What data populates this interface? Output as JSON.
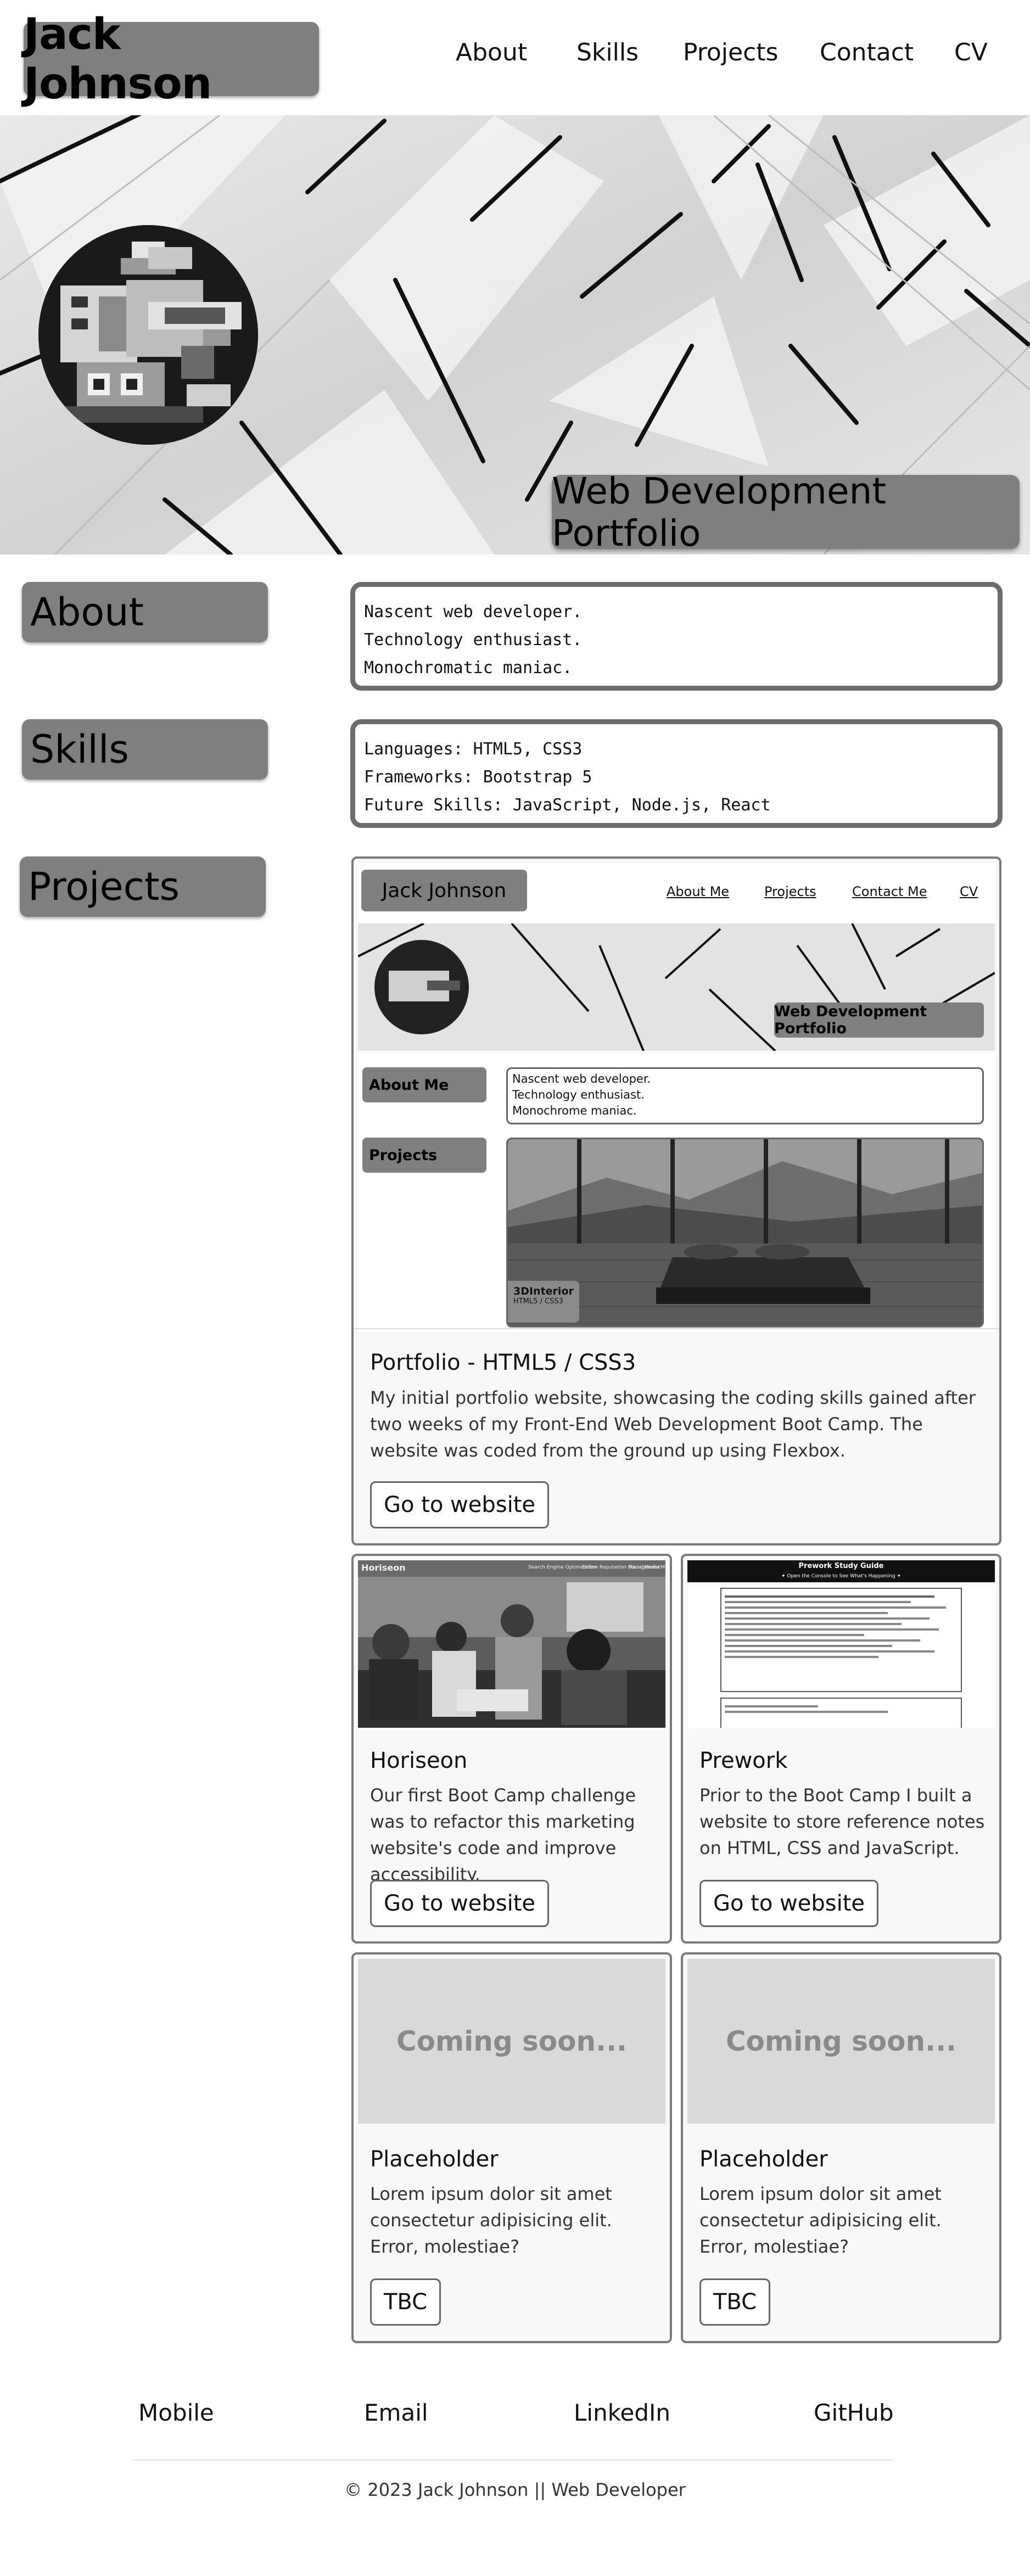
{
  "header": {
    "brand": "Jack Johnson",
    "nav": [
      "About",
      "Skills",
      "Projects",
      "Contact",
      "CV"
    ]
  },
  "hero": {
    "title": "Web Development Portfolio"
  },
  "about": {
    "label": "About",
    "lines": [
      "Nascent web developer.",
      "Technology enthusiast.",
      "Monochromatic maniac."
    ]
  },
  "skills": {
    "label": "Skills",
    "lines": [
      "Languages: HTML5, CSS3",
      "Frameworks: Bootstrap 5",
      "Future Skills: JavaScript, Node.js, React"
    ]
  },
  "projects": {
    "label": "Projects",
    "preview": {
      "brand": "Jack Johnson",
      "nav": [
        "About Me",
        "Projects",
        "Contact Me",
        "CV"
      ],
      "hero_title": "Web Development Portfolio",
      "about_label": "About Me",
      "about_lines": [
        "Nascent web developer.",
        "Technology enthusiast.",
        "Monochrome maniac."
      ],
      "projects_label": "Projects",
      "project_name": "3DInterior",
      "project_tech": "HTML5 / CSS3"
    },
    "cards": [
      {
        "title": "Portfolio - HTML5 / CSS3",
        "text": "My initial portfolio website, showcasing the coding skills gained after two weeks of my Front-End Web Development Boot Camp. The website was coded from the ground up using Flexbox.",
        "button": "Go to website"
      },
      {
        "title": "Horiseon",
        "text": "Our first Boot Camp challenge was to refactor this marketing website's code and improve accessibility.",
        "button": "Go to website",
        "thumb_brand": "Horiseon",
        "thumb_nav": [
          "Search Engine Optimization",
          "Online Reputation Management",
          "Social Media Marketing"
        ]
      },
      {
        "title": "Prework",
        "text": "Prior to the Boot Camp I built a website to store reference notes on HTML, CSS and JavaScript.",
        "button": "Go to website",
        "thumb_title": "Prework Study Guide",
        "thumb_subtitle": "✦ Open the Console to See What's Happening ✦"
      },
      {
        "title": "Placeholder",
        "text": "Lorem ipsum dolor sit amet consectetur adipisicing elit. Error, molestiae?",
        "button": "TBC",
        "image_text": "Coming soon..."
      },
      {
        "title": "Placeholder",
        "text": "Lorem ipsum dolor sit amet consectetur adipisicing elit. Error, molestiae?",
        "button": "TBC",
        "image_text": "Coming soon..."
      }
    ]
  },
  "footer": {
    "links": [
      "Mobile",
      "Email",
      "LinkedIn",
      "GitHub"
    ],
    "copyright": "© 2023 Jack Johnson || Web Developer"
  },
  "colors": {
    "label_bg": "#7f7f7f",
    "box_border": "#6d6d6d",
    "card_bg": "#f7f8f9"
  }
}
